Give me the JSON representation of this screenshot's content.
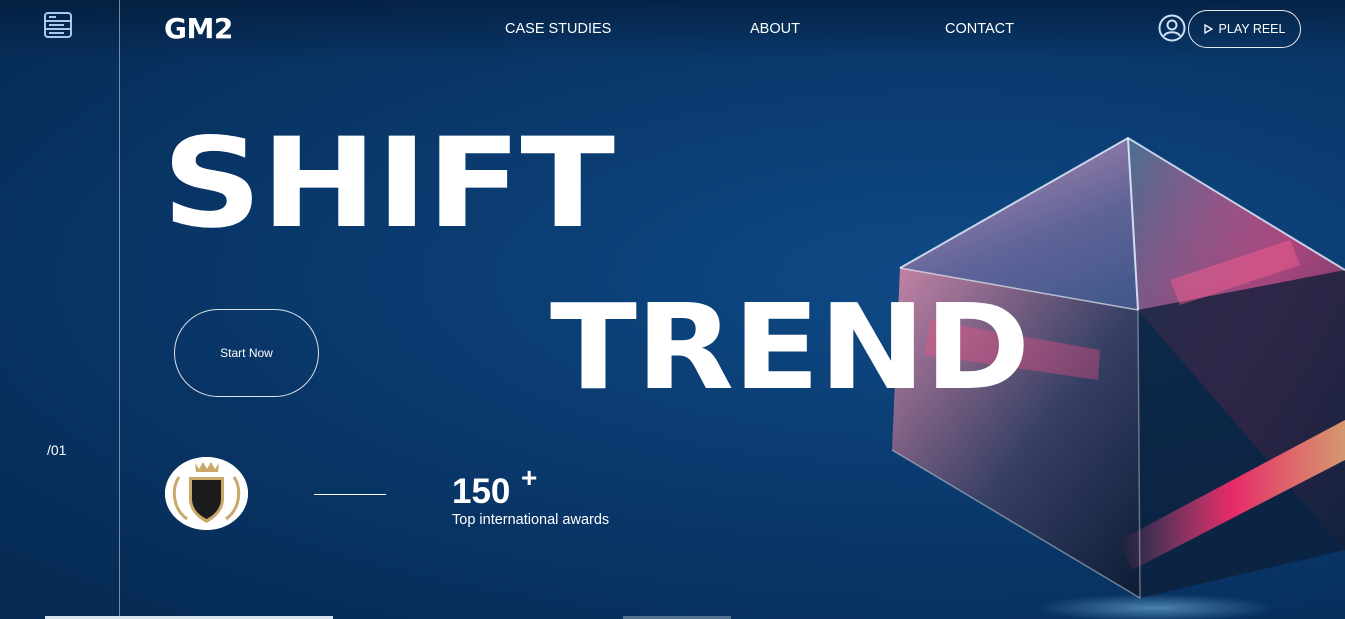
{
  "header": {
    "logo": "GM2",
    "nav": [
      {
        "label": "CASE STUDIES"
      },
      {
        "label": "ABOUT"
      },
      {
        "label": "CONTACT"
      }
    ],
    "play_reel_label": "PLAY REEL"
  },
  "icons": {
    "menu": "server-stack-icon",
    "user": "user-circle-icon",
    "play": "play-triangle-icon"
  },
  "hero": {
    "words": [
      "SHIFT",
      "TREND"
    ],
    "cta_label": "Start Now",
    "slide_index": "/01"
  },
  "stat": {
    "value": "150",
    "suffix": "+",
    "label": "Top international awards"
  },
  "slider": {
    "slides": 4,
    "active": 1
  },
  "colors": {
    "background": "#0a3b70",
    "text": "#ffffff",
    "accent_pink": "#ff3c78"
  }
}
